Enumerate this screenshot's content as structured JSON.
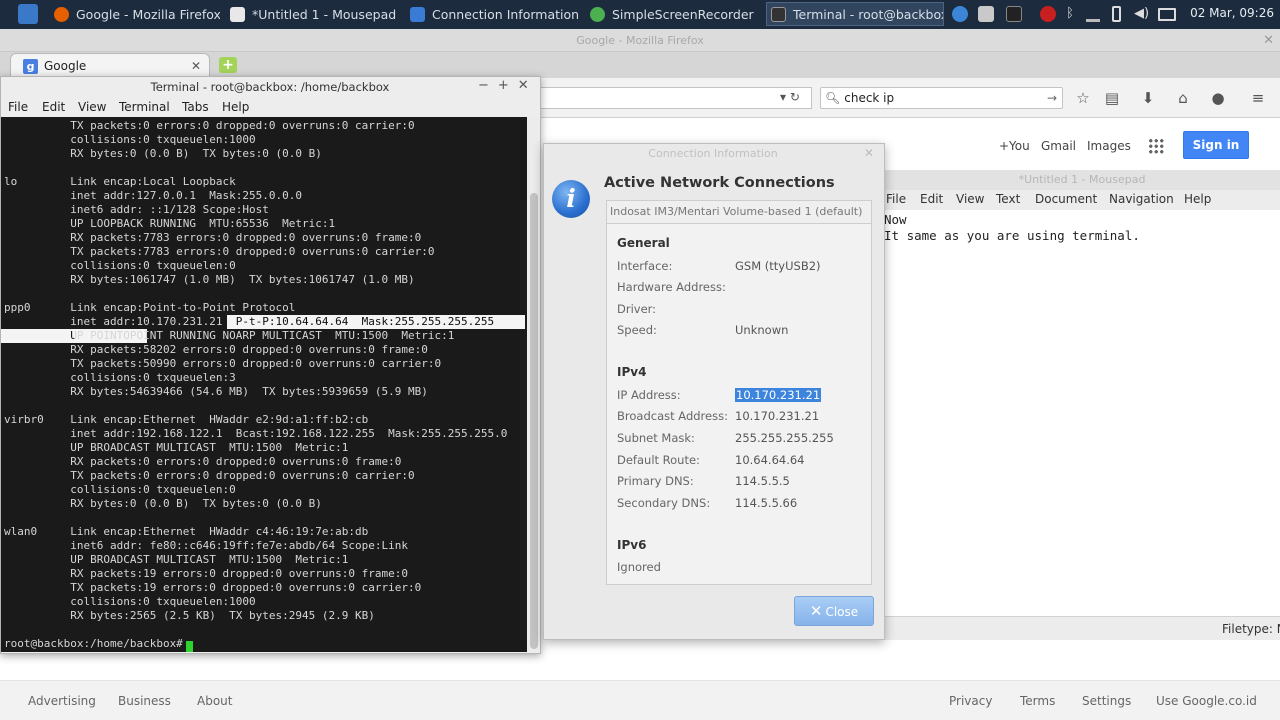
{
  "taskbar": {
    "tasks": [
      {
        "label": "Google - Mozilla Firefox",
        "color": "#e66000"
      },
      {
        "label": "*Untitled 1 - Mousepad",
        "color": "#e8e8e8"
      },
      {
        "label": "Connection Information",
        "color": "#3a7bd5"
      },
      {
        "label": "SimpleScreenRecorder",
        "color": "#4caf50"
      },
      {
        "label": "Terminal - root@backbox:...",
        "color": "#333333"
      }
    ],
    "clock": "02 Mar, 09:26"
  },
  "firefox": {
    "window_title": "Google - Mozilla Firefox",
    "tab_label": "Google",
    "search_value": "check ip",
    "google_links": {
      "plus_you": "+You",
      "gmail": "Gmail",
      "images": "Images"
    },
    "sign_in": "Sign in",
    "footer": {
      "advertising": "Advertising",
      "business": "Business",
      "about": "About",
      "privacy": "Privacy",
      "terms": "Terms",
      "settings": "Settings",
      "use_google": "Use Google.co.id"
    }
  },
  "mousepad": {
    "title": "*Untitled 1 - Mousepad",
    "menu": {
      "file": "File",
      "edit": "Edit",
      "view": "View",
      "text": "Text",
      "document": "Document",
      "navigation": "Navigation",
      "help": "Help"
    },
    "lines": [
      "Now",
      "It same as you are using terminal."
    ],
    "status": "Filetype: N"
  },
  "terminal": {
    "title": "Terminal - root@backbox: /home/backbox",
    "menu": {
      "file": "File",
      "edit": "Edit",
      "view": "View",
      "terminal": "Terminal",
      "tabs": "Tabs",
      "help": "Help"
    },
    "lines": [
      "          TX packets:0 errors:0 dropped:0 overruns:0 carrier:0",
      "          collisions:0 txqueuelen:1000",
      "          RX bytes:0 (0.0 B)  TX bytes:0 (0.0 B)",
      "",
      "lo        Link encap:Local Loopback",
      "          inet addr:127.0.0.1  Mask:255.0.0.0",
      "          inet6 addr: ::1/128 Scope:Host",
      "          UP LOOPBACK RUNNING  MTU:65536  Metric:1",
      "          RX packets:7783 errors:0 dropped:0 overruns:0 frame:0",
      "          TX packets:7783 errors:0 dropped:0 overruns:0 carrier:0",
      "          collisions:0 txqueuelen:0",
      "          RX bytes:1061747 (1.0 MB)  TX bytes:1061747 (1.0 MB)",
      "",
      "ppp0      Link encap:Point-to-Point Protocol",
      "          inet addr:10.170.231.21  P-t-P:10.64.64.64  Mask:255.255.255.255",
      "          UP POINTOPOINT RUNNING NOARP MULTICAST  MTU:1500  Metric:1",
      "          RX packets:58202 errors:0 dropped:0 overruns:0 frame:0",
      "          TX packets:50990 errors:0 dropped:0 overruns:0 carrier:0",
      "          collisions:0 txqueuelen:3",
      "          RX bytes:54639466 (54.6 MB)  TX bytes:5939659 (5.9 MB)",
      "",
      "virbr0    Link encap:Ethernet  HWaddr e2:9d:a1:ff:b2:cb",
      "          inet addr:192.168.122.1  Bcast:192.168.122.255  Mask:255.255.255.0",
      "          UP BROADCAST MULTICAST  MTU:1500  Metric:1",
      "          RX packets:0 errors:0 dropped:0 overruns:0 frame:0",
      "          TX packets:0 errors:0 dropped:0 overruns:0 carrier:0",
      "          collisions:0 txqueuelen:0",
      "          RX bytes:0 (0.0 B)  TX bytes:0 (0.0 B)",
      "",
      "wlan0     Link encap:Ethernet  HWaddr c4:46:19:7e:ab:db",
      "          inet6 addr: fe80::c646:19ff:fe7e:abdb/64 Scope:Link",
      "          UP BROADCAST MULTICAST  MTU:1500  Metric:1",
      "          RX packets:19 errors:0 dropped:0 overruns:0 frame:0",
      "          TX packets:19 errors:0 dropped:0 overruns:0 carrier:0",
      "          collisions:0 txqueuelen:1000",
      "          RX bytes:2565 (2.5 KB)  TX bytes:2945 (2.9 KB)",
      "",
      "root@backbox:/home/backbox#"
    ]
  },
  "conn_info": {
    "title": "Connection Information",
    "heading": "Active Network Connections",
    "tab": "Indosat IM3/Mentari Volume-based 1 (default)",
    "general_title": "General",
    "interface_label": "Interface:",
    "interface_value": "GSM (ttyUSB2)",
    "hw_label": "Hardware Address:",
    "driver_label": "Driver:",
    "speed_label": "Speed:",
    "speed_value": "Unknown",
    "ipv4_title": "IPv4",
    "ip_label": "IP Address:",
    "ip_value": "10.170.231.21",
    "bcast_label": "Broadcast Address:",
    "bcast_value": "10.170.231.21",
    "mask_label": "Subnet Mask:",
    "mask_value": "255.255.255.255",
    "route_label": "Default Route:",
    "route_value": "10.64.64.64",
    "dns1_label": "Primary DNS:",
    "dns1_value": "114.5.5.5",
    "dns2_label": "Secondary DNS:",
    "dns2_value": "114.5.5.66",
    "ipv6_title": "IPv6",
    "ipv6_value": "Ignored",
    "close_label": "Close"
  }
}
